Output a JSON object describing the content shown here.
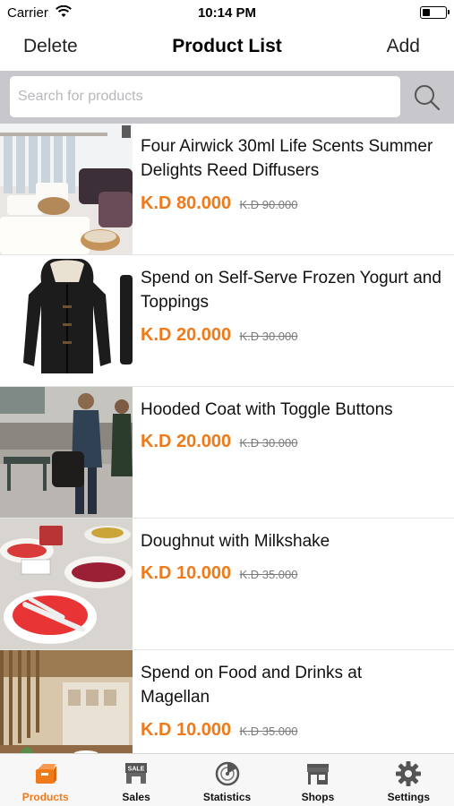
{
  "status_bar": {
    "carrier": "Carrier",
    "time": "10:14 PM",
    "battery_level": 0.25
  },
  "nav": {
    "left_label": "Delete",
    "title": "Product List",
    "right_label": "Add"
  },
  "search": {
    "placeholder": "Search for products",
    "value": ""
  },
  "products": [
    {
      "name": "Four Airwick 30ml Life Scents Summer Delights Reed Diffusers",
      "price": "K.D 80.000",
      "old_price": "K.D 90.000",
      "image": "salon-interior"
    },
    {
      "name": "Spend on Self-Serve Frozen Yogurt and Toppings",
      "price": "K.D 20.000",
      "old_price": "K.D 30.000",
      "image": "black-hooded-coat"
    },
    {
      "name": "Hooded Coat with Toggle Buttons",
      "price": "K.D 20.000",
      "old_price": "K.D 30.000",
      "image": "street-people"
    },
    {
      "name": "Doughnut with Milkshake",
      "price": "K.D 10.000",
      "old_price": "K.D 35.000",
      "image": "fruit-bar"
    },
    {
      "name": "Spend on Food and Drinks at Magellan",
      "price": "K.D 10.000",
      "old_price": "K.D 35.000",
      "image": "restaurant-interior"
    }
  ],
  "tabs": [
    {
      "label": "Products",
      "icon": "products-box-icon",
      "active": true
    },
    {
      "label": "Sales",
      "icon": "sale-sign-icon",
      "active": false
    },
    {
      "label": "Statistics",
      "icon": "statistics-dial-icon",
      "active": false
    },
    {
      "label": "Shops",
      "icon": "shop-storefront-icon",
      "active": false
    },
    {
      "label": "Settings",
      "icon": "gear-icon",
      "active": false
    }
  ],
  "colors": {
    "accent": "#ef7a1a",
    "search_background": "#c7c7cc",
    "tab_bar_background": "#f7f7f7"
  }
}
